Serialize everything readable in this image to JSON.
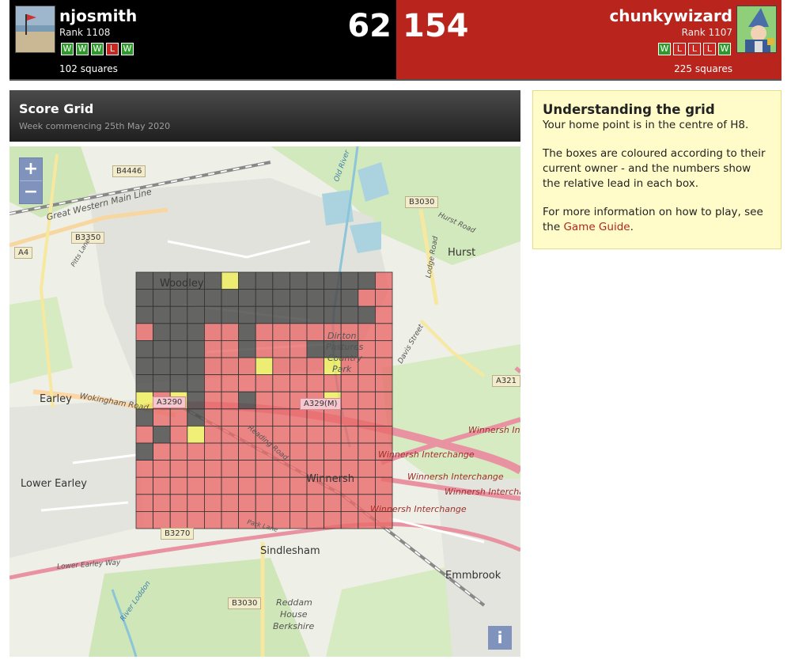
{
  "match": {
    "left_player": {
      "name": "njosmith",
      "rank": "Rank 1108",
      "results": [
        "W",
        "W",
        "W",
        "L",
        "W"
      ],
      "squares": "102 squares",
      "score": "62"
    },
    "right_player": {
      "name": "chunkywizard",
      "rank": "Rank 1107",
      "results": [
        "W",
        "L",
        "L",
        "L",
        "W"
      ],
      "squares": "225 squares",
      "score": "154"
    }
  },
  "panel": {
    "title": "Score Grid",
    "subtitle": "Week commencing 25th May 2020"
  },
  "map": {
    "zoom_in": "+",
    "zoom_out": "−",
    "info": "i",
    "places": {
      "woodley": "Woodley",
      "earley": "Earley",
      "lower_earley": "Lower Earley",
      "winnersh": "Winnersh",
      "sindlesham": "Sindlesham",
      "emmbrook": "Emmbrook",
      "hurst": "Hurst",
      "reddam": "Reddam",
      "house": "House",
      "berkshire": "Berkshire",
      "dinton1": "Dinton",
      "dinton2": "Pastures",
      "dinton3": "Country",
      "dinton4": "Park"
    },
    "roads": {
      "b4446": "B4446",
      "b3350": "B3350",
      "a4": "A4",
      "b3030a": "B3030",
      "b3030b": "B3030",
      "a321": "A321",
      "b3270": "B3270",
      "a3290": "A3290",
      "a329m": "A329(M)"
    },
    "road_names": {
      "great_western": "Great Western Main Line",
      "wokingham": "Wokingham Road",
      "winnersh_ic1": "Winnersh Interchange",
      "winnersh_ic2": "Winnersh Interchange",
      "winnersh_ic3": "Winnersh Interchange",
      "winnersh_ic4": "Winnersh Interchange",
      "winnersh_in": "Winnersh In",
      "lower_earley_way": "Lower Earley Way",
      "hurst_road": "Hurst Road",
      "lodge_road": "Lodge Road",
      "davis_street": "Davis Street",
      "reading_road": "Reading Road",
      "old_river": "Old River",
      "river_loddon": "River Loddon",
      "pitts_lane": "Pitts Lane",
      "park_lane": "Park Lane"
    },
    "grid": {
      "rows": 15,
      "cols": 15,
      "owners": [
        "XXXXXYXXXXXXXXRR",
        "XXXXXXXXXXXXXRRR",
        "XXXXXXXXXXXXXXRR",
        "RXXXRRXRRRRRRRRR",
        "XXXXRRXRRRXXXRRR",
        "XXXXRRRYRRRYRRRR",
        "XXXXRRRRRRRRRRRR",
        "YRYXRRXRRRRYRRRR",
        "XRRXRRRRRRRRRRRR",
        "RXRYRRRRRRRRRRRR",
        "XRRRRRRRRRRRRRRR",
        "RRRRRRRRRRRRRRRR",
        "RRRRRRRRRRRRRRRR",
        "RRRRRRRRRRRRRRRR",
        "RRRRRRRRRRRRRRRR"
      ],
      "colors": {
        "X": "#4d4d4d",
        "R": "#e86a6a",
        "Y": "#f0f05a"
      }
    }
  },
  "help": {
    "title": "Understanding the grid",
    "line1": "Your home point is in the centre of H8.",
    "para2": "The boxes are coloured according to their current owner - and the numbers show the relative lead in each box.",
    "para3_prefix": "For more information on how to play, see the ",
    "para3_link": "Game Guide",
    "para3_suffix": "."
  }
}
